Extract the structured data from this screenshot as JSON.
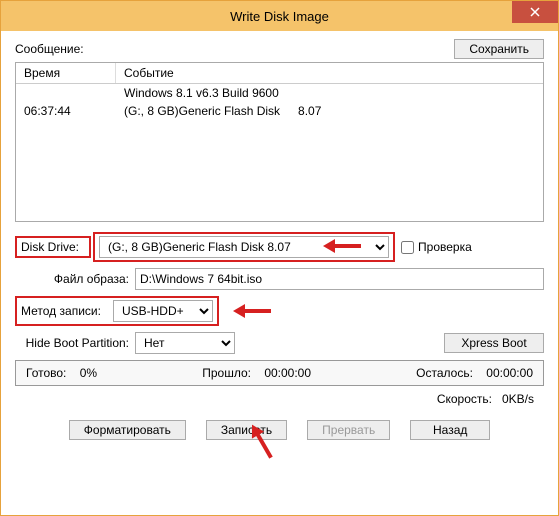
{
  "window": {
    "title": "Write Disk Image"
  },
  "message": {
    "label": "Сообщение:",
    "save_button": "Сохранить"
  },
  "log": {
    "header_time": "Время",
    "header_event": "Событие",
    "rows": [
      {
        "time": "",
        "event": "Windows 8.1 v6.3 Build 9600",
        "extra": ""
      },
      {
        "time": "06:37:44",
        "event": "(G:, 8 GB)Generic Flash Disk",
        "extra": "8.07"
      }
    ]
  },
  "drive": {
    "label": "Disk Drive:",
    "value": "(G:, 8 GB)Generic Flash Disk      8.07",
    "check_label": "Проверка"
  },
  "image_file": {
    "label": "Файл образа:",
    "value": "D:\\Windows 7 64bit.iso"
  },
  "method": {
    "label": "Метод записи:",
    "value": "USB-HDD+"
  },
  "hide_partition": {
    "label": "Hide Boot Partition:",
    "value": "Нет",
    "xpress_button": "Xpress Boot"
  },
  "progress": {
    "done_label": "Готово:",
    "done_value": "0%",
    "elapsed_label": "Прошло:",
    "elapsed_value": "00:00:00",
    "remain_label": "Осталось:",
    "remain_value": "00:00:00"
  },
  "speed": {
    "label": "Скорость:",
    "value": "0KB/s"
  },
  "buttons": {
    "format": "Форматировать",
    "write": "Записать",
    "abort": "Прервать",
    "back": "Назад"
  }
}
